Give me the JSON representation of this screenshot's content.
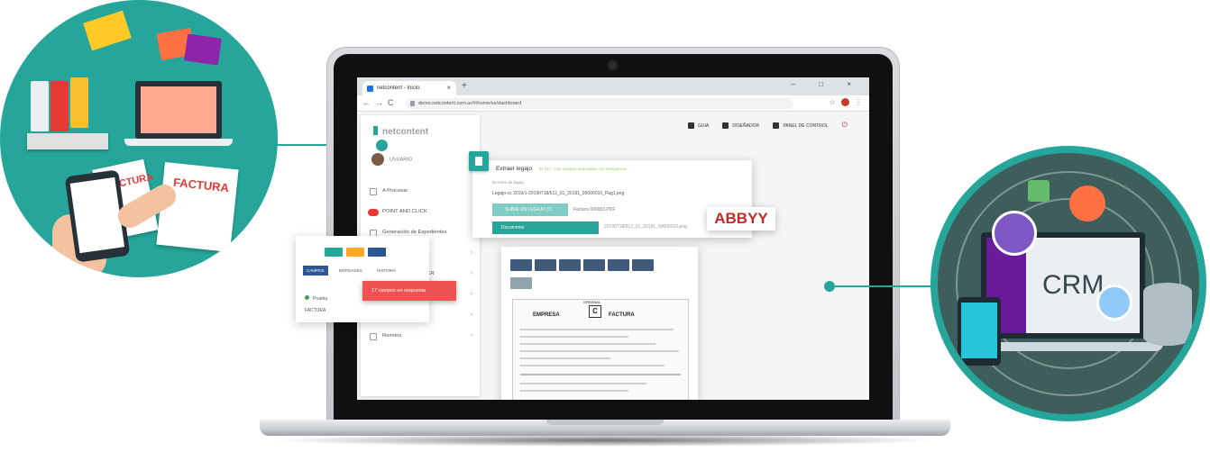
{
  "browser": {
    "tab_title": "netcontent - Inicio",
    "tab_close": "×",
    "new_tab": "+",
    "window_controls": "–  □  ×",
    "nav_back": "←",
    "nav_forward": "→",
    "nav_reload": "C",
    "url": "demo.netcontent.com.ar/#/home/es/dashboard",
    "star": "☆"
  },
  "app": {
    "brand": "netcontent",
    "user_name": "USUARIO",
    "topnav": {
      "guide": "GUIA",
      "designer": "DISEÑADOR",
      "control_panel": "PANEL DE CONTROL"
    },
    "menu": [
      {
        "label": "A Procesar",
        "icon": "square-icon",
        "has_chevron": false
      },
      {
        "label": "POINT AND CLICK",
        "icon": "badge",
        "has_chevron": false
      },
      {
        "label": "Generación de Expedientes",
        "icon": "square-icon",
        "has_chevron": false
      },
      {
        "label": "CONTRATISTAS",
        "icon": "square-icon",
        "has_chevron": true
      },
      {
        "label": "Facturas ABBYY OCR",
        "icon": "badge",
        "has_chevron": true
      },
      {
        "label": "INEGrow",
        "icon": "badge",
        "has_chevron": true
      },
      {
        "label": "No Clasificados",
        "icon": "square-icon",
        "has_chevron": true
      },
      {
        "label": "Remitos",
        "icon": "square-icon",
        "has_chevron": true
      }
    ],
    "chevron": "›",
    "panel_upload": {
      "title": "Extraer legajo",
      "subtitle": "ID 617 - con campos indexables con inteligencia",
      "field_label": "Nombre de legajo",
      "path": "Legajo-cc 2019/1-20190718/512_01_20191_00000010_Pag1.png",
      "upload_button": "SUBIR UN LEGAJO (1)",
      "file_name": "Factura 000003.PDF",
      "select_button": "Documento",
      "select_value": "20190718/512_01_20191_00000010.png"
    },
    "abbyy_logo": "ABBYY",
    "invoice": {
      "empresa": "EMPRESA",
      "letter": "C",
      "original": "ORIGINAL",
      "factura": "FACTURA"
    },
    "panel_fields": {
      "tabs": [
        "CAMPOS",
        "ENTIDADES",
        "HISTORIA"
      ],
      "leaf_label": "Prueba",
      "factura_label": "FACTURA"
    },
    "toast": "17 campos en respuesta"
  },
  "illustrations": {
    "left_factura_1": "FACTURA",
    "left_factura_2": "FACTURA",
    "crm_label": "CRM"
  },
  "colors": {
    "brand_teal": "#26a69a",
    "danger_red": "#ef5350",
    "nav_blue": "#3f5a7a",
    "abbyy_red": "#c62828"
  }
}
